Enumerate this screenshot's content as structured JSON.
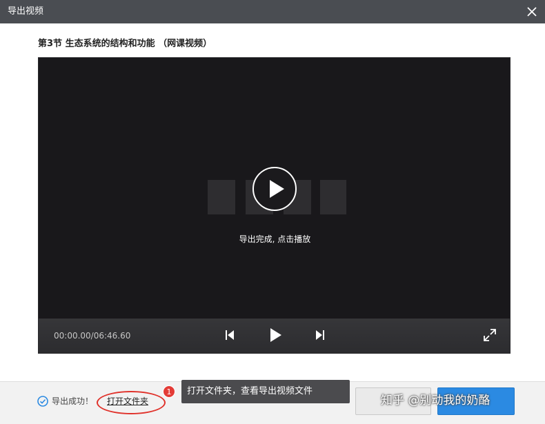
{
  "window": {
    "title": "导出视频",
    "close_icon": "close-icon"
  },
  "video": {
    "title": "第3节 生态系统的结构和功能 （网课视频）",
    "overlay_message": "导出完成, 点击播放",
    "play_icon": "play-circle-icon"
  },
  "controls": {
    "time": "00:00.00/06:46.60",
    "prev_icon": "skip-previous-icon",
    "play_icon": "play-icon",
    "next_icon": "skip-next-icon",
    "fullscreen_icon": "fullscreen-icon"
  },
  "footer": {
    "status_icon": "check-circle-icon",
    "status_text": "导出成功！",
    "open_folder_link": "打开文件夹",
    "badge_number": "1",
    "tooltip_text": "打开文件夹，查看导出视频文件",
    "attribution": "知乎 @别动我的奶酪"
  },
  "colors": {
    "titlebar": "#4a4d52",
    "player_bg": "#19181b",
    "accent_blue": "#2b8ae2",
    "highlight_red": "#e0322b"
  }
}
